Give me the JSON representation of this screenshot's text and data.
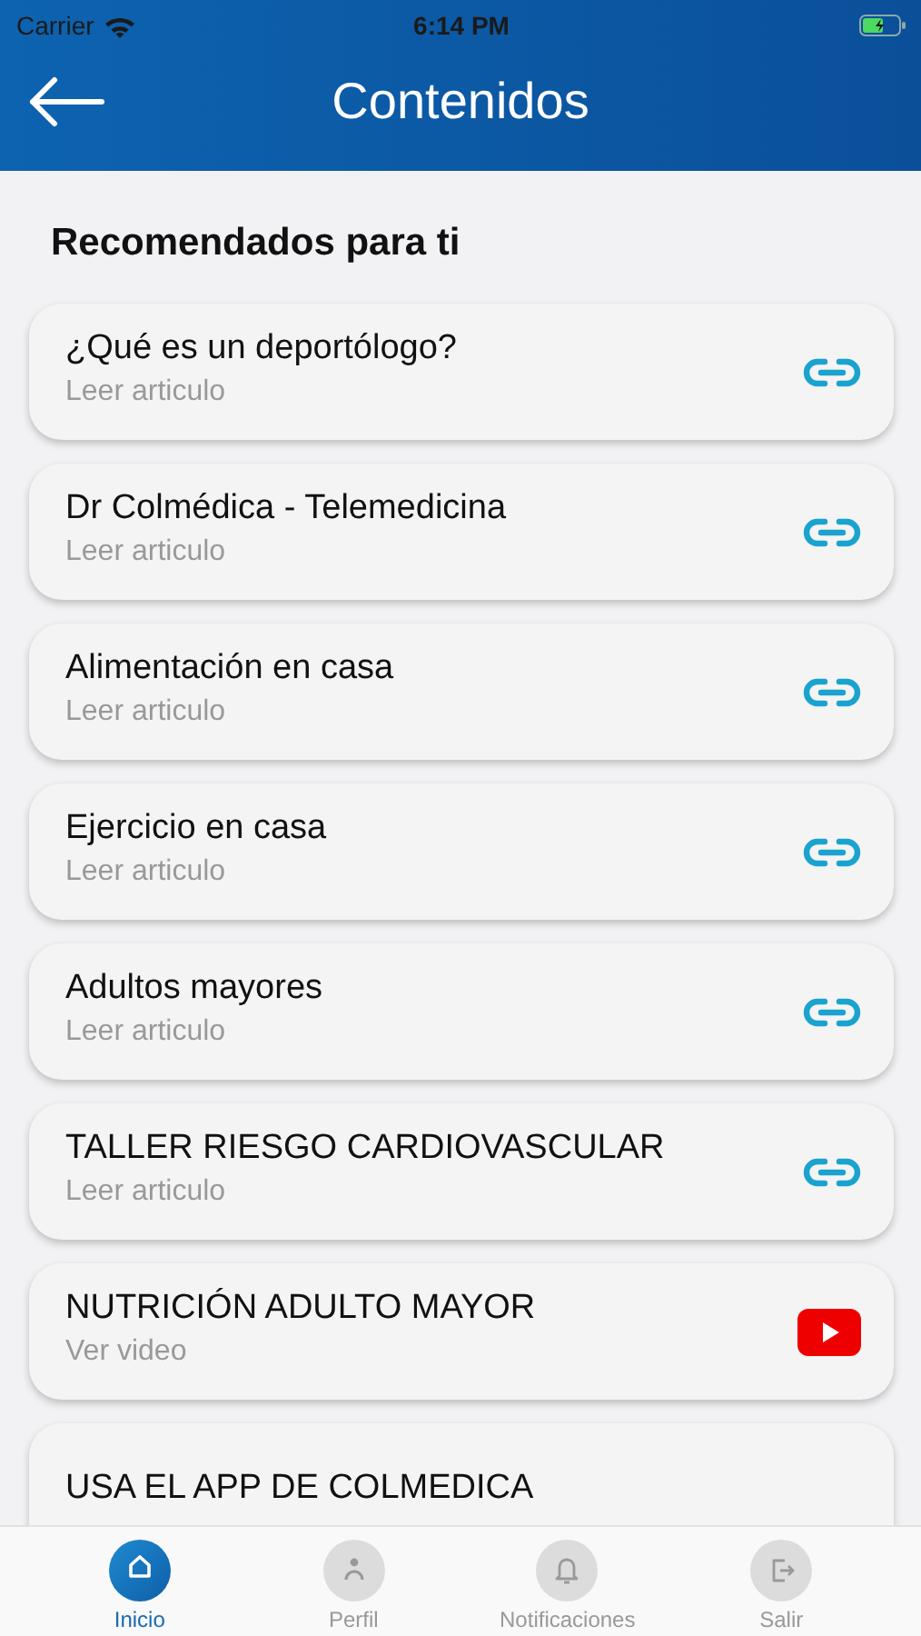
{
  "status_bar": {
    "carrier": "Carrier",
    "time": "6:14 PM"
  },
  "header": {
    "title": "Contenidos"
  },
  "section": {
    "title": "Recomendados para ti"
  },
  "items": [
    {
      "title": "¿Qué es un deportólogo?",
      "subtitle": "Leer articulo",
      "kind": "link"
    },
    {
      "title": "Dr Colmédica - Telemedicina",
      "subtitle": "Leer articulo",
      "kind": "link"
    },
    {
      "title": "Alimentación en casa",
      "subtitle": "Leer articulo",
      "kind": "link"
    },
    {
      "title": "Ejercicio en casa",
      "subtitle": "Leer articulo",
      "kind": "link"
    },
    {
      "title": "Adultos mayores",
      "subtitle": "Leer articulo",
      "kind": "link"
    },
    {
      "title": "TALLER RIESGO CARDIOVASCULAR",
      "subtitle": "Leer articulo",
      "kind": "link"
    },
    {
      "title": "NUTRICIÓN ADULTO MAYOR",
      "subtitle": "Ver video",
      "kind": "video"
    },
    {
      "title": "USA EL APP DE COLMEDICA"
    }
  ],
  "nav": [
    {
      "label": "Inicio",
      "kind": "home",
      "selected": true
    },
    {
      "label": "Perfil",
      "kind": "profile",
      "selected": false
    },
    {
      "label": "Notificaciones",
      "kind": "bell",
      "selected": false
    },
    {
      "label": "Salir",
      "kind": "exit",
      "selected": false
    }
  ]
}
